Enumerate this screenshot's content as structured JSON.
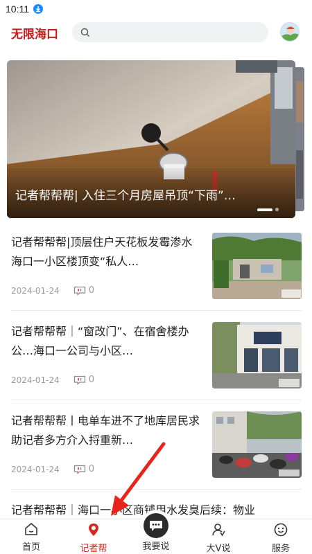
{
  "status_bar": {
    "time": "10:11"
  },
  "header": {
    "logo": "无限海口",
    "search": {
      "placeholder": "",
      "value": ""
    }
  },
  "banner": {
    "title": "记者帮帮帮| 入住三个月房屋吊顶“下雨”…"
  },
  "news": [
    {
      "title": "记者帮帮帮|顶层住户天花板发霉渗水海口一小区楼顶变“私人…",
      "date": "2024-01-24",
      "comments": "0"
    },
    {
      "title": "记者帮帮帮｜“窗改门”、在宿舍楼办公…海口一公司与小区…",
      "date": "2024-01-24",
      "comments": "0"
    },
    {
      "title": "记者帮帮帮丨电单车进不了地库居民求助记者多方介入捋重新…",
      "date": "2024-01-24",
      "comments": "0"
    },
    {
      "title": "记者帮帮帮｜海口一小区商铺用水发臭后续：物业",
      "date": "",
      "comments": ""
    }
  ],
  "tabbar": {
    "tabs": [
      {
        "label": "首页",
        "icon": "home-icon"
      },
      {
        "label": "记者帮",
        "icon": "location-pin-icon",
        "active": true
      },
      {
        "label": "我要说",
        "icon": "chat-bubble-icon"
      },
      {
        "label": "大V说",
        "icon": "v-user-icon"
      },
      {
        "label": "服务",
        "icon": "smiley-icon"
      }
    ]
  },
  "colors": {
    "brand": "#c81a1a",
    "active_tab": "#d42a1e",
    "meta_gray": "#9a9a9a",
    "annotation_arrow": "#e8251c"
  }
}
